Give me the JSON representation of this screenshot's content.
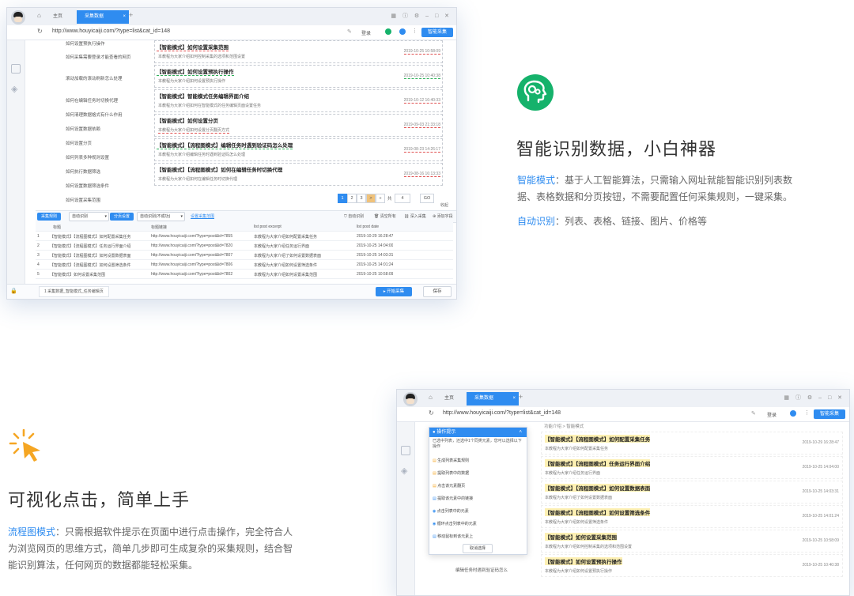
{
  "win1": {
    "tabs": [
      "主页",
      "采集数据"
    ],
    "url": "http://www.houyicaiji.com/?type=list&cat_id=148",
    "addr_login": "登录",
    "addr_btn": "智能采集",
    "tree": [
      "如何设置预执行操作",
      "如何采集需要登录才能查看的网页",
      "滚动加载的滚动刷新怎么处理",
      "如何在编辑任务时切换代理",
      "如何清理数据格式有什么作用",
      "如何设置数据依赖",
      "如何设置分页",
      "如何列表多种规则设置",
      "如何执行数据筛选",
      "如何设置数据筛选条件",
      "如何设置采集范围"
    ],
    "cards": [
      {
        "title": "【智能模式】如何设置采集范围",
        "excerpt": "本教程为大家介绍如何控制采集的选项和范围设置",
        "date": "2019-10-25 10:58:09"
      },
      {
        "title": "【智能模式】如何设置预执行操作",
        "excerpt": "本教程为大家介绍如何设置预执行操作",
        "date": "2019-10-25 10:40:38"
      },
      {
        "title": "【智能模式】智能模式任务编辑界面介绍",
        "excerpt": "本教程为大家介绍如何在智能模式的任务编辑页面设置任务",
        "date": "2019-10-12 16:40:33"
      },
      {
        "title": "【智能模式】如何设置分页",
        "excerpt": "本教程为大家介绍如何设置分页翻页方式",
        "date": "2019-09-03 21:33:18"
      },
      {
        "title": "【智能模式】【流程图模式】编辑任务时遇到验证码怎么处理",
        "excerpt": "本教程为大家介绍编辑任务时遇到验证码怎么处理",
        "date": "2019-08-23 14:26:17"
      },
      {
        "title": "【智能模式】【流程图模式】如何在编辑任务时切换代理",
        "excerpt": "本教程为大家介绍如何在编辑任务时切换代理",
        "date": "2019-08-16 16:13:33"
      }
    ],
    "pager": [
      "1",
      "2",
      "3",
      ">",
      "»"
    ],
    "pager_total": "共",
    "pager_input": "4",
    "pager_go": "GO",
    "pager_collapse": "收起",
    "toolbar": {
      "rule_label": "采集规则",
      "rule_value": "自动识别",
      "paging_label": "分页设置",
      "paging_value": "自动识别(不成功)",
      "page_link": "设置采集范围",
      "act1": "自动识别",
      "act2": "清空所有",
      "act3": "深入采集",
      "act4": "添加字段"
    },
    "table_headers": [
      "标题",
      "标题链接",
      "list post excerpt",
      "list post date"
    ],
    "rows": [
      {
        "n": "1",
        "title": "【智能模式】【流程图模式】如何配置采集任务",
        "link": "http://www.houyicaiji.com/?type=post&id=7855",
        "excerpt": "本教程为大家介绍如何配置采集任务",
        "date": "2019-10-29 16:28:47"
      },
      {
        "n": "2",
        "title": "【智能模式】【流程图模式】任务运行界面介绍",
        "link": "http://www.houyicaiji.com/?type=post&id=7820",
        "excerpt": "本教程为大家介绍任务运行界面",
        "date": "2019-10-25 14:04:00"
      },
      {
        "n": "3",
        "title": "【智能模式】【流程图模式】如何设置数据表面",
        "link": "http://www.houyicaiji.com/?type=post&id=7807",
        "excerpt": "本教程为大家介绍了如何设置数据表面",
        "date": "2019-10-25 14:03:31"
      },
      {
        "n": "4",
        "title": "【智能模式】【流程图模式】如何设置筛选条件",
        "link": "http://www.houyicaiji.com/?type=post&id=7806",
        "excerpt": "本教程为大家介绍如何设置筛选条件",
        "date": "2019-10-25 14:01:24"
      },
      {
        "n": "5",
        "title": "【智能模式】如何设置采集范围",
        "link": "http://www.houyicaiji.com/?type=post&id=7802",
        "excerpt": "本教程为大家介绍如何设置采集范围",
        "date": "2019-10-25 10:58:09"
      }
    ],
    "status": "1 采集数据_智能模式_任务编辑页",
    "start_btn": "开始采集",
    "save_btn": "保存"
  },
  "feature1": {
    "title": "智能识别数据，小白神器",
    "kw1": "智能模式",
    "text1": "：基于人工智能算法，只需输入网址就能智能识别列表数据、表格数据和分页按钮，不需要配置任何采集规则，一键采集。",
    "kw2": "自动识别",
    "text2": "：列表、表格、链接、图片、价格等"
  },
  "feature2": {
    "title": "可视化点击，简单上手",
    "kw": "流程图模式",
    "text": "：只需根据软件提示在页面中进行点击操作，完全符合人为浏览网页的思维方式，简单几步即可生成复杂的采集规则，结合智能识别算法，任何网页的数据都能轻松采集。"
  },
  "win2": {
    "tabs": [
      "主页",
      "采集数据"
    ],
    "url": "http://www.houyicaiji.com/?type=list&cat_id=148",
    "addr_login": "登录",
    "addr_btn": "智能采集",
    "breadcrumb": "功能介绍 > 智能模式",
    "popup_title": "操作提示",
    "popup_desc": "已选中列表，还选中1个同类元素，您可以选择以下操作",
    "popup_items": [
      "生成列表采集规则",
      "提取列表中的数据",
      "点击该元素翻页",
      "提取该元素中的链接",
      "点击列表中的元素",
      "循环点击列表中的元素",
      "移动鼠标到该元素上"
    ],
    "popup_cancel": "取消选择",
    "tree_bottom": "编辑任务时遇到验证码怎么",
    "cards": [
      {
        "title": "【智能模式】【流程图模式】如何配置采集任务",
        "excerpt": "本教程为大家介绍如何配置采集任务",
        "date": "2019-10-29 16:28:47"
      },
      {
        "title": "【智能模式】【流程图模式】任务运行界面介绍",
        "excerpt": "本教程为大家介绍任务运行界面",
        "date": "2019-10-25 14:04:00"
      },
      {
        "title": "【智能模式】【流程图模式】如何设置数据表面",
        "excerpt": "本教程为大家介绍了如何设置数据表面",
        "date": "2019-10-25 14:03:31"
      },
      {
        "title": "【智能模式】【流程图模式】如何设置筛选条件",
        "excerpt": "本教程为大家介绍如何设置筛选条件",
        "date": "2019-10-25 14:01:24"
      },
      {
        "title": "【智能模式】如何设置采集范围",
        "excerpt": "本教程为大家介绍如何控制采集的选项和范围设置",
        "date": "2019-10-25 10:58:09"
      },
      {
        "title": "【智能模式】如何设置预执行操作",
        "excerpt": "本教程为大家介绍如何设置预执行操作",
        "date": "2019-10-25 10:40:38"
      }
    ]
  },
  "colors": {
    "accent": "#2f8cf0",
    "brand_green": "#15b26b",
    "title": "#333333",
    "text": "#666666",
    "click_orange": "#f5a623"
  }
}
